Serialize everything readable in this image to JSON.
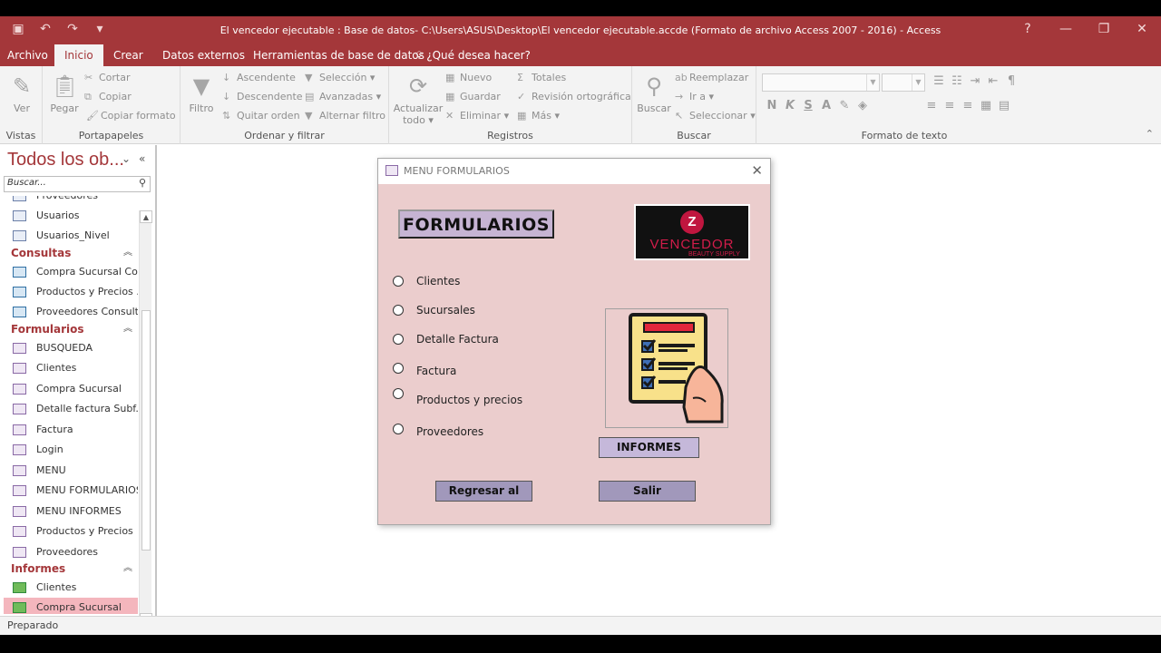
{
  "window": {
    "title": "El vencedor ejecutable : Base de datos- C:\\Users\\ASUS\\Desktop\\El vencedor ejecutable.accde (Formato de archivo Access 2007 - 2016) - Access",
    "help": "?",
    "minimize": "—",
    "restore": "❐",
    "close": "✕"
  },
  "tabs": {
    "archivo": "Archivo",
    "inicio": "Inicio",
    "crear": "Crear",
    "datos_externos": "Datos externos",
    "herramientas": "Herramientas de base de datos",
    "tell_me": "¿Qué desea hacer?"
  },
  "ribbon": {
    "vistas": {
      "label": "Vistas",
      "ver": "Ver"
    },
    "portapapeles": {
      "label": "Portapapeles",
      "pegar": "Pegar",
      "cortar": "Cortar",
      "copiar": "Copiar",
      "copiar_formato": "Copiar formato"
    },
    "ordenar": {
      "label": "Ordenar y filtrar",
      "filtro": "Filtro",
      "ascendente": "Ascendente",
      "descendente": "Descendente",
      "quitar_orden": "Quitar orden",
      "seleccion": "Selección",
      "avanzadas": "Avanzadas",
      "alternar_filtro": "Alternar filtro"
    },
    "registros": {
      "label": "Registros",
      "actualizar": "Actualizar",
      "todo": "todo",
      "nuevo": "Nuevo",
      "guardar": "Guardar",
      "eliminar": "Eliminar",
      "totales": "Totales",
      "revision": "Revisión ortográfica",
      "mas": "Más"
    },
    "buscar": {
      "label": "Buscar",
      "buscar": "Buscar",
      "reemplazar": "Reemplazar",
      "ir_a": "Ir a",
      "seleccionar": "Seleccionar"
    },
    "formato": {
      "label": "Formato de texto",
      "negrita": "N",
      "cursiva": "K",
      "subrayado": "S",
      "color_fuente": "A"
    }
  },
  "nav": {
    "title": "Todos los ob...",
    "search_placeholder": "Buscar...",
    "items": [
      {
        "type": "table",
        "label": "Proveedores"
      },
      {
        "type": "table",
        "label": "Usuarios"
      },
      {
        "type": "table",
        "label": "Usuarios_Nivel"
      }
    ],
    "categories": {
      "consultas": "Consultas",
      "formularios": "Formularios",
      "informes": "Informes"
    },
    "consultas": [
      "Compra Sucursal Co...",
      "Productos y Precios ...",
      "Proveedores Consulta"
    ],
    "formularios": [
      "BUSQUEDA",
      "Clientes",
      "Compra Sucursal",
      "Detalle factura Subf...",
      "Factura",
      "Login",
      "MENU",
      "MENU FORMULARIOS",
      "MENU INFORMES",
      "Productos y Precios",
      "Proveedores"
    ],
    "informes": [
      "Clientes",
      "Compra Sucursal"
    ]
  },
  "dialog": {
    "title": "MENU FORMULARIOS",
    "header": "FORMULARIOS",
    "logo": {
      "mark": "Z",
      "name": "VENCEDOR",
      "sub": "BEAUTY SUPPLY"
    },
    "options": [
      "Clientes",
      "Sucursales",
      "Detalle Factura",
      "Factura",
      "Productos y precios",
      "Proveedores"
    ],
    "informes_btn": "INFORMES",
    "regresar_btn": "Regresar al",
    "salir_btn": "Salir"
  },
  "status": {
    "text": "Preparado"
  },
  "colors": {
    "accent": "#a4373a",
    "form_bg": "#ebcdcd",
    "button": "#a198bb"
  }
}
